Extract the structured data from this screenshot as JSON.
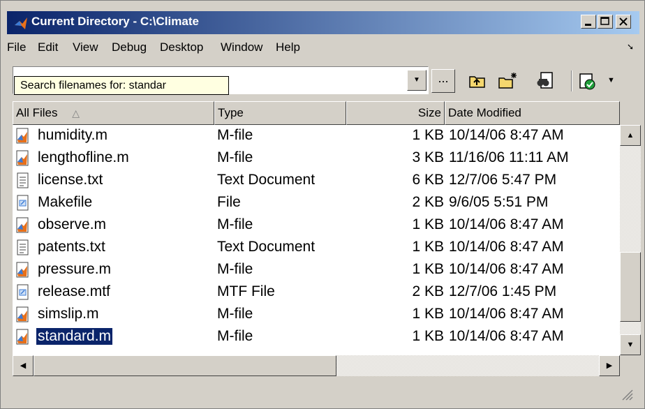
{
  "window": {
    "title": "Current Directory - C:\\Climate"
  },
  "title_buttons": {
    "minimize": "_",
    "maximize": "□",
    "close": "✕"
  },
  "menu": [
    "File",
    "Edit",
    "View",
    "Debug",
    "Desktop",
    "Window",
    "Help"
  ],
  "menu_extra_icon": "undock-arrow-icon",
  "address": {
    "value": ""
  },
  "tooltip": "Search filenames for: standar",
  "toolbar": {
    "browse_label": "...",
    "icons": [
      "up-folder-icon",
      "new-folder-icon",
      "find-files-icon",
      "report-icon"
    ]
  },
  "columns": {
    "name": "All Files",
    "type": "Type",
    "size": "Size",
    "date": "Date Modified",
    "sort_indicator": "△"
  },
  "files": [
    {
      "name": "humidity.m",
      "type": "M-file",
      "size": "1 KB",
      "date": "10/14/06 8:47 AM",
      "icon": "m-file-icon"
    },
    {
      "name": "lengthofline.m",
      "type": "M-file",
      "size": "3 KB",
      "date": "11/16/06 11:11 AM",
      "icon": "m-file-icon"
    },
    {
      "name": "license.txt",
      "type": "Text Document",
      "size": "6 KB",
      "date": "12/7/06 5:47 PM",
      "icon": "text-file-icon"
    },
    {
      "name": "Makefile",
      "type": "File",
      "size": "2 KB",
      "date": "9/6/05 5:51 PM",
      "icon": "generic-file-icon"
    },
    {
      "name": "observe.m",
      "type": "M-file",
      "size": "1 KB",
      "date": "10/14/06 8:47 AM",
      "icon": "m-file-icon"
    },
    {
      "name": "patents.txt",
      "type": "Text Document",
      "size": "1 KB",
      "date": "10/14/06 8:47 AM",
      "icon": "text-file-icon"
    },
    {
      "name": "pressure.m",
      "type": "M-file",
      "size": "1 KB",
      "date": "10/14/06 8:47 AM",
      "icon": "m-file-icon"
    },
    {
      "name": "release.mtf",
      "type": "MTF File",
      "size": "2 KB",
      "date": "12/7/06 1:45 PM",
      "icon": "generic-file-icon"
    },
    {
      "name": "simslip.m",
      "type": "M-file",
      "size": "1 KB",
      "date": "10/14/06 8:47 AM",
      "icon": "m-file-icon"
    },
    {
      "name": "standard.m",
      "type": "M-file",
      "size": "1 KB",
      "date": "10/14/06 8:47 AM",
      "icon": "m-file-icon",
      "selected": true
    }
  ],
  "colors": {
    "title_start": "#0a246a",
    "title_end": "#a6caf0",
    "selection": "#0a246a",
    "tooltip_bg": "#ffffe1",
    "chrome": "#d4d0c8"
  }
}
